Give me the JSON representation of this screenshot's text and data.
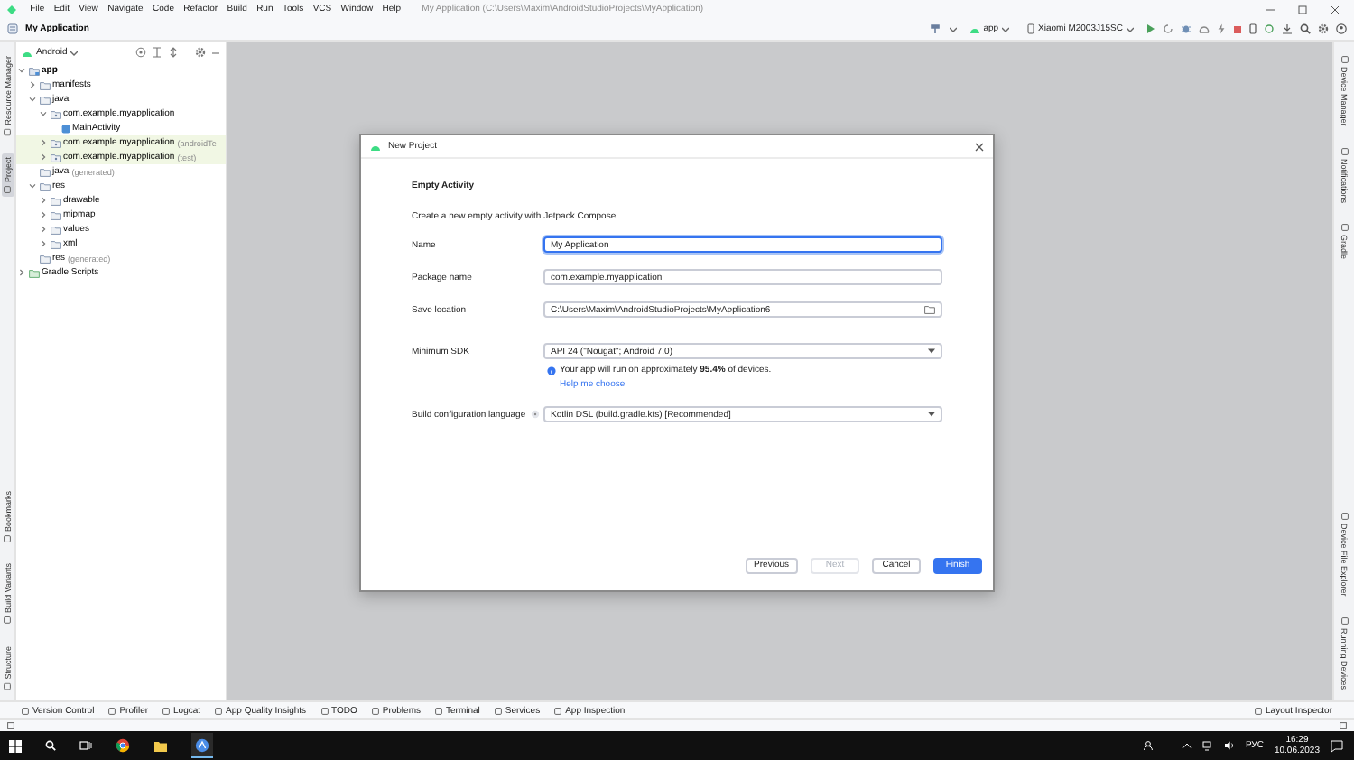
{
  "window": {
    "title": "My Application (C:\\Users\\Maxim\\AndroidStudioProjects\\MyApplication)",
    "menu": [
      "File",
      "Edit",
      "View",
      "Navigate",
      "Code",
      "Refactor",
      "Build",
      "Run",
      "Tools",
      "VCS",
      "Window",
      "Help"
    ]
  },
  "toolbar": {
    "breadcrumb": "My Application",
    "run_config": "app",
    "device": "Xiaomi M2003J15SC"
  },
  "left_strip": {
    "top": [
      {
        "label": "Resource Manager",
        "selected": false
      },
      {
        "label": "Project",
        "selected": true
      }
    ],
    "bottom": [
      {
        "label": "Bookmarks",
        "selected": false
      },
      {
        "label": "Build Variants",
        "selected": false
      },
      {
        "label": "Structure",
        "selected": false
      }
    ]
  },
  "project_panel": {
    "view": "Android",
    "tree": [
      {
        "kind": "module",
        "label": "app",
        "expanded": true,
        "highlighted": false,
        "children": [
          {
            "kind": "folder",
            "label": "manifests",
            "expanded": false,
            "highlighted": false
          },
          {
            "kind": "folder",
            "label": "java",
            "expanded": true,
            "highlighted": false,
            "children": [
              {
                "kind": "package",
                "label": "com.example.myapplication",
                "expanded": true,
                "highlighted": false,
                "children": [
                  {
                    "kind": "class",
                    "label": "MainActivity",
                    "highlighted": false
                  }
                ]
              },
              {
                "kind": "package",
                "label": "com.example.myapplication",
                "note": "(androidTe",
                "expanded": false,
                "highlighted": true
              },
              {
                "kind": "package",
                "label": "com.example.myapplication",
                "note": "(test)",
                "expanded": false,
                "highlighted": true
              }
            ]
          },
          {
            "kind": "folder",
            "label": "java",
            "note": "(generated)",
            "highlighted": false
          },
          {
            "kind": "folder",
            "label": "res",
            "expanded": true,
            "highlighted": false,
            "children": [
              {
                "kind": "folder",
                "label": "drawable",
                "expanded": false,
                "highlighted": false
              },
              {
                "kind": "folder",
                "label": "mipmap",
                "expanded": false,
                "highlighted": false
              },
              {
                "kind": "folder",
                "label": "values",
                "expanded": false,
                "highlighted": false
              },
              {
                "kind": "folder",
                "label": "xml",
                "expanded": false,
                "highlighted": false
              }
            ]
          },
          {
            "kind": "folder",
            "label": "res",
            "note": "(generated)",
            "highlighted": false
          }
        ]
      },
      {
        "kind": "gradle",
        "label": "Gradle Scripts",
        "expanded": false,
        "highlighted": false
      }
    ]
  },
  "dialog": {
    "title": "New Project",
    "heading": "Empty Activity",
    "description": "Create a new empty activity with Jetpack Compose",
    "fields": [
      {
        "kind": "text",
        "label": "Name",
        "value": "My Application",
        "focused": true
      },
      {
        "kind": "text",
        "label": "Package name",
        "value": "com.example.myapplication",
        "focused": false
      },
      {
        "kind": "folder",
        "label": "Save location",
        "value": "C:\\Users\\Maxim\\AndroidStudioProjects\\MyApplication6",
        "focused": false
      },
      {
        "kind": "dropdown",
        "label": "Minimum SDK",
        "value": "API 24 (\"Nougat\"; Android 7.0)",
        "focused": false,
        "info": "Your app will run on approximately **95.4%** of devices.",
        "link": "Help me choose"
      },
      {
        "kind": "dropdown",
        "label": "Build configuration language",
        "help": true,
        "value": "Kotlin DSL (build.gradle.kts) [Recommended]",
        "focused": false
      }
    ],
    "buttons": [
      {
        "label": "Previous",
        "primary": false,
        "disabled": false
      },
      {
        "label": "Next",
        "primary": false,
        "disabled": true
      },
      {
        "label": "Cancel",
        "primary": false,
        "disabled": false
      },
      {
        "label": "Finish",
        "primary": true,
        "disabled": false
      }
    ]
  },
  "right_strip": {
    "top": [
      {
        "label": "Device Manager",
        "selected": false
      },
      {
        "label": "Notifications",
        "selected": false
      },
      {
        "label": "Gradle",
        "selected": false
      }
    ],
    "bottom": [
      {
        "label": "Device File Explorer",
        "selected": false
      },
      {
        "label": "Running Devices",
        "selected": false
      }
    ]
  },
  "bottom_tools": {
    "left": [
      "Version Control",
      "Profiler",
      "Logcat",
      "App Quality Insights",
      "TODO",
      "Problems",
      "Terminal",
      "Services",
      "App Inspection"
    ],
    "right": [
      "Layout Inspector"
    ]
  },
  "taskbar": {
    "language": "РУС",
    "time": "16:29",
    "date": "10.06.2023"
  }
}
